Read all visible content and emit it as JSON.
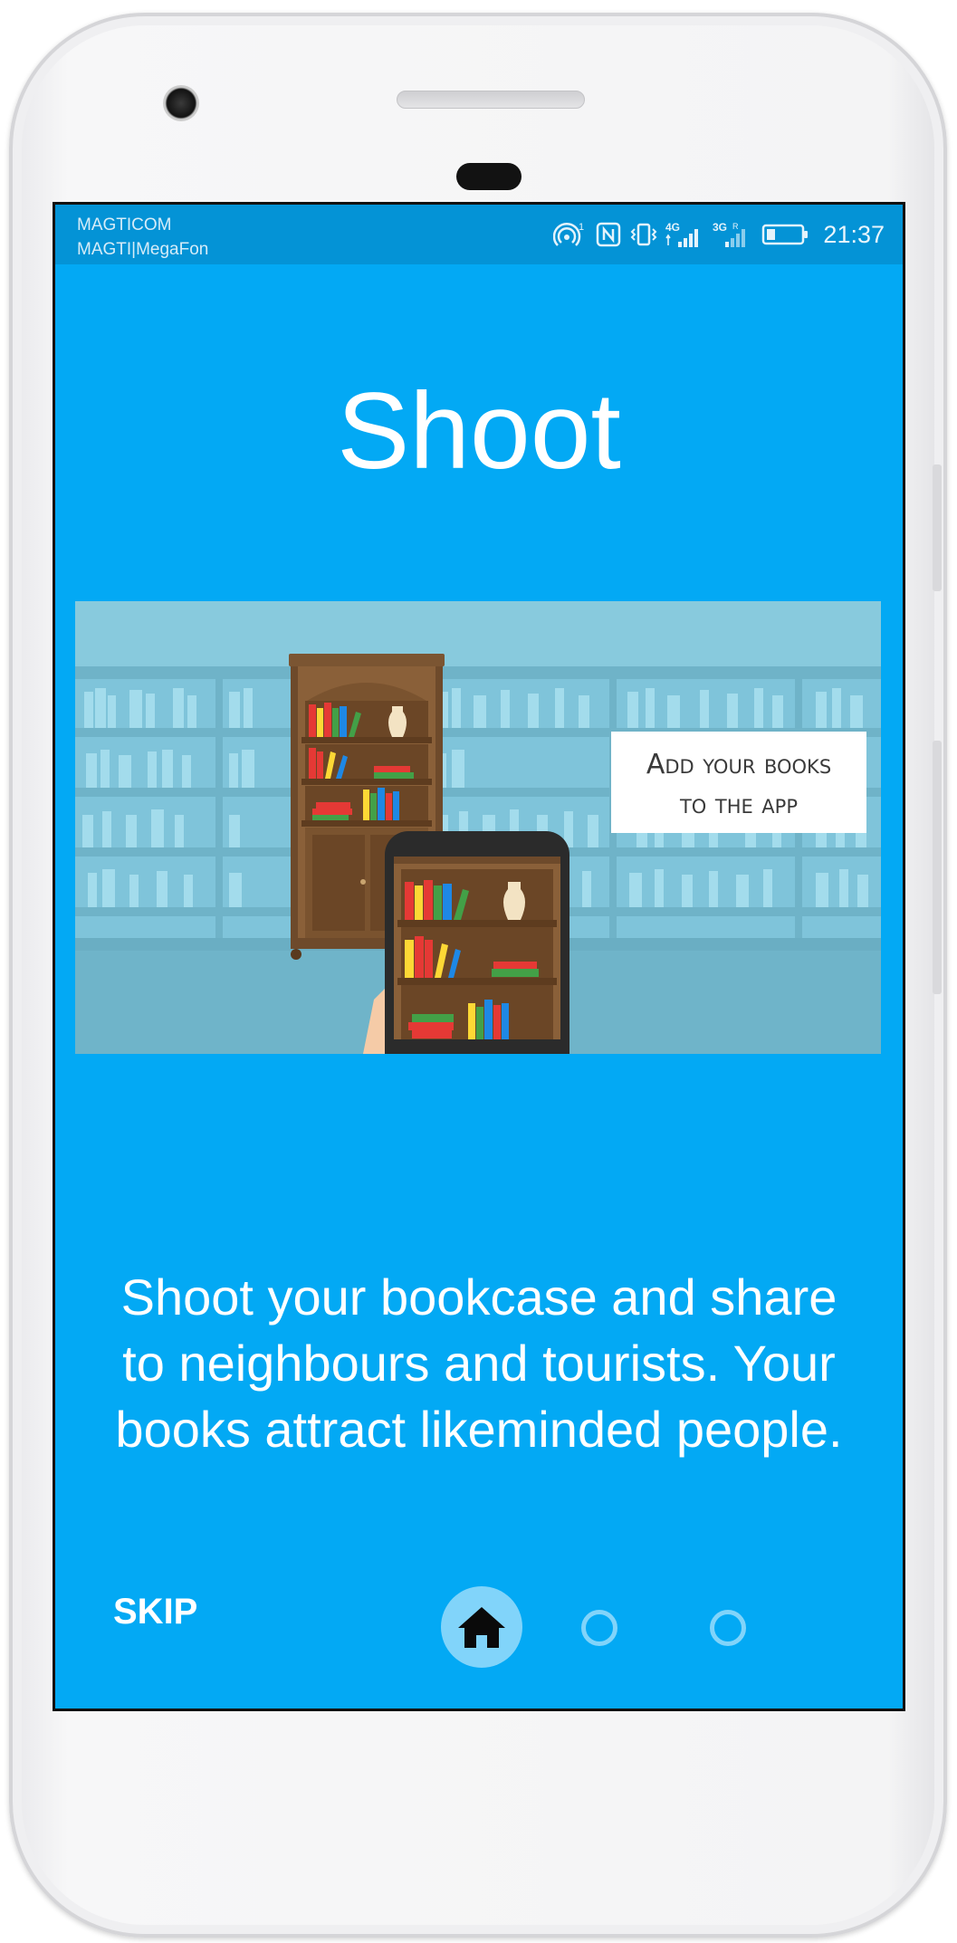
{
  "status_bar": {
    "carrier_primary": "MAGTICOM",
    "carrier_secondary": "MAGTI|MegaFon",
    "network_1": "4G",
    "network_2": "3G",
    "time": "21:37",
    "icons": [
      "hotspot-icon",
      "nfc-icon",
      "vibrate-icon",
      "signal-4g-icon",
      "signal-3g-icon",
      "battery-icon"
    ]
  },
  "onboarding": {
    "title": "Shoot",
    "illustration": {
      "banner_line1": "Add your books",
      "banner_line2": "to the app"
    },
    "description": "Shoot your bookcase and share to neighbours and tourists. Your books attract likeminded people.",
    "skip_label": "SKIP",
    "pagination": {
      "current": 1,
      "total": 3,
      "active_icon": "home-icon"
    }
  },
  "colors": {
    "screen_background": "#03a9f4",
    "status_bar": "#0493d6",
    "indicator": "#81d4fa",
    "text": "#ffffff"
  }
}
